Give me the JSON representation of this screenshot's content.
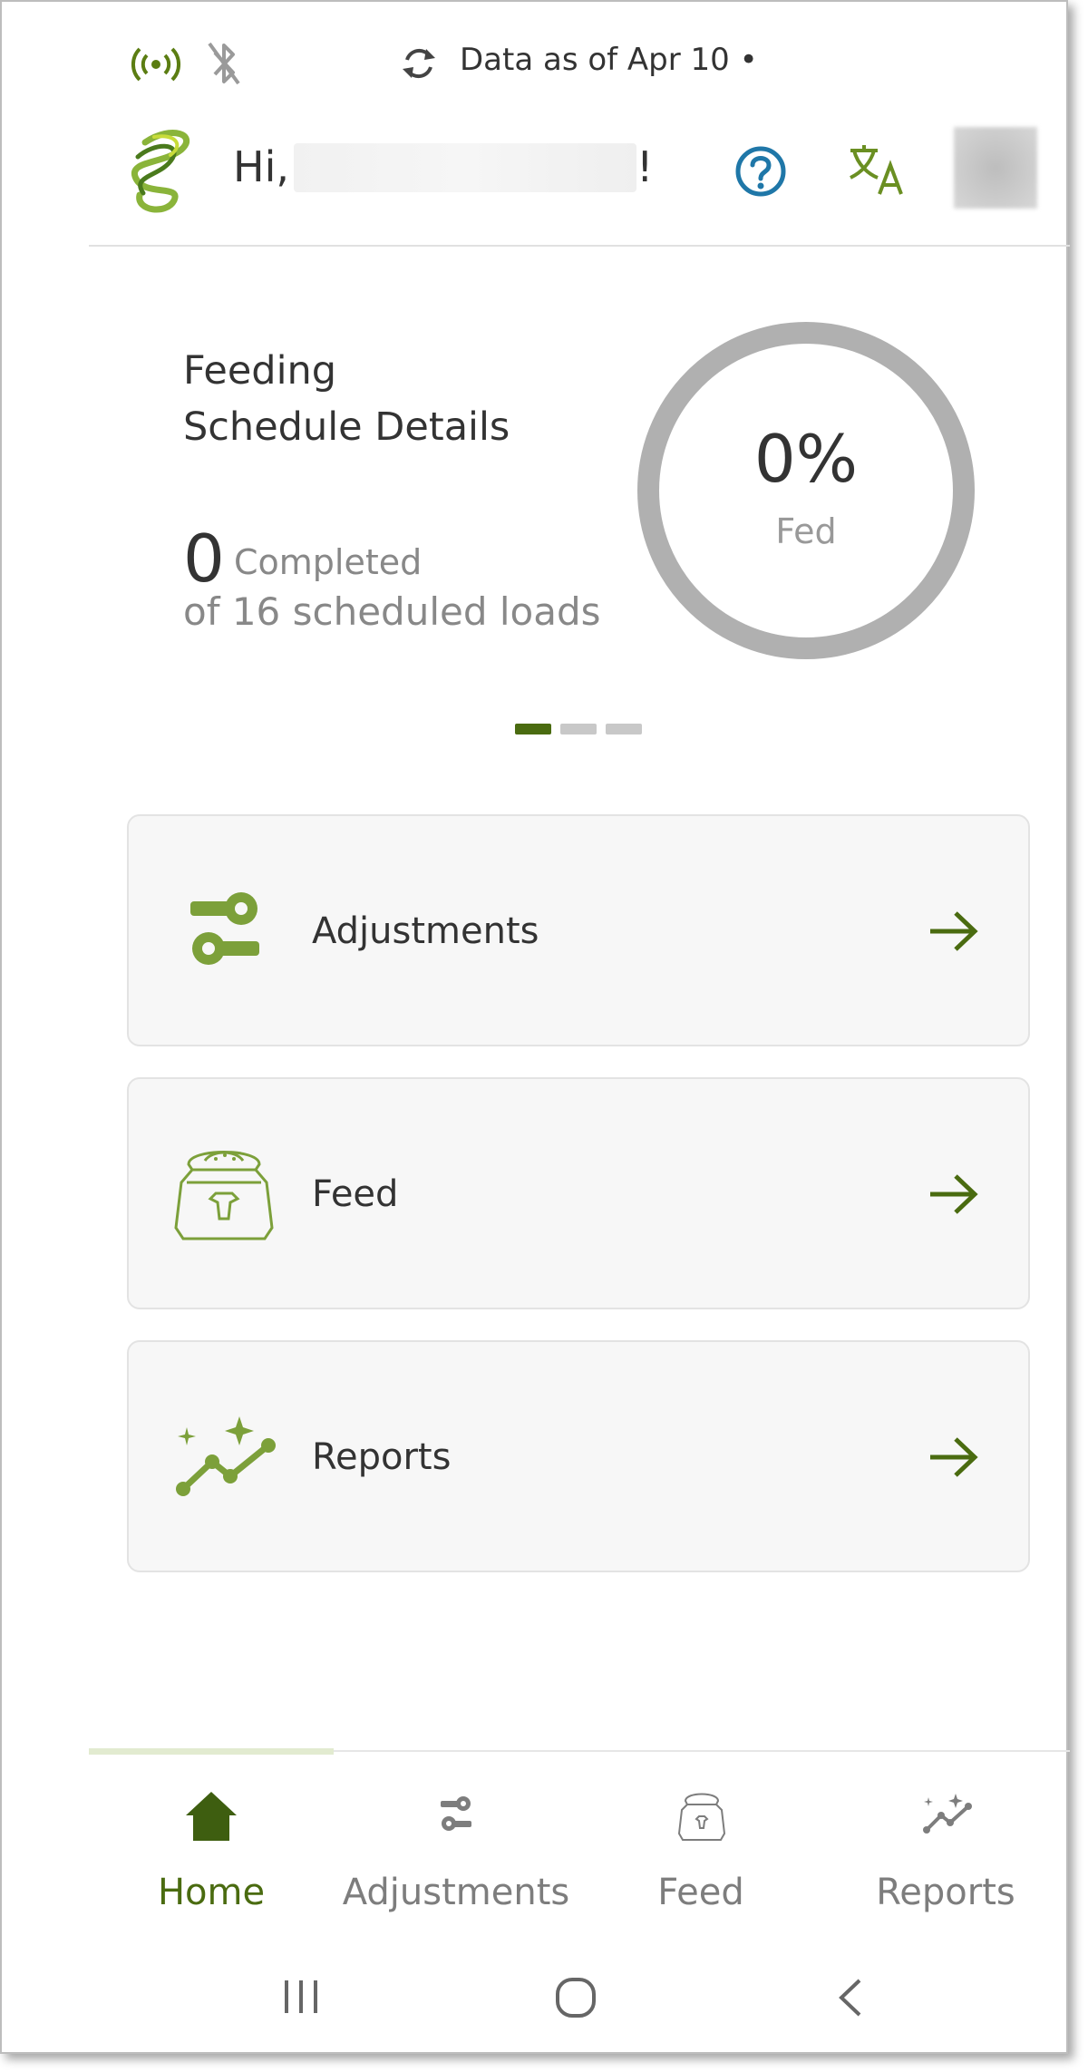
{
  "status_bar": {
    "data_as_of": "Data as of Apr 10 • ("
  },
  "header": {
    "greeting_prefix": "Hi,",
    "greeting_suffix": "!",
    "help_icon": "help-circle-icon",
    "translate_icon": "translate-icon"
  },
  "summary": {
    "title_line1": "Feeding",
    "title_line2": "Schedule Details",
    "completed_count": "0",
    "completed_label": "Completed",
    "scheduled_text": "of 16 scheduled loads",
    "percent_text": "0%",
    "percent_value": 0,
    "fed_label": "Fed"
  },
  "pager": {
    "total": 3,
    "active": 0
  },
  "cards": [
    {
      "label": "Adjustments",
      "icon": "adjustments-icon"
    },
    {
      "label": "Feed",
      "icon": "feed-bag-icon"
    },
    {
      "label": "Reports",
      "icon": "reports-chart-icon"
    }
  ],
  "bottom_nav": [
    {
      "label": "Home",
      "icon": "home-icon",
      "active": true
    },
    {
      "label": "Adjustments",
      "icon": "adjustments-icon",
      "active": false
    },
    {
      "label": "Feed",
      "icon": "feed-bag-icon",
      "active": false
    },
    {
      "label": "Reports",
      "icon": "reports-chart-icon",
      "active": false
    }
  ],
  "colors": {
    "accent": "#7ca03a",
    "accent_dark": "#4a6b10",
    "help_blue": "#1f77a8",
    "ring_grey": "#b0b0b0",
    "inactive_nav": "#7d7d7d"
  }
}
